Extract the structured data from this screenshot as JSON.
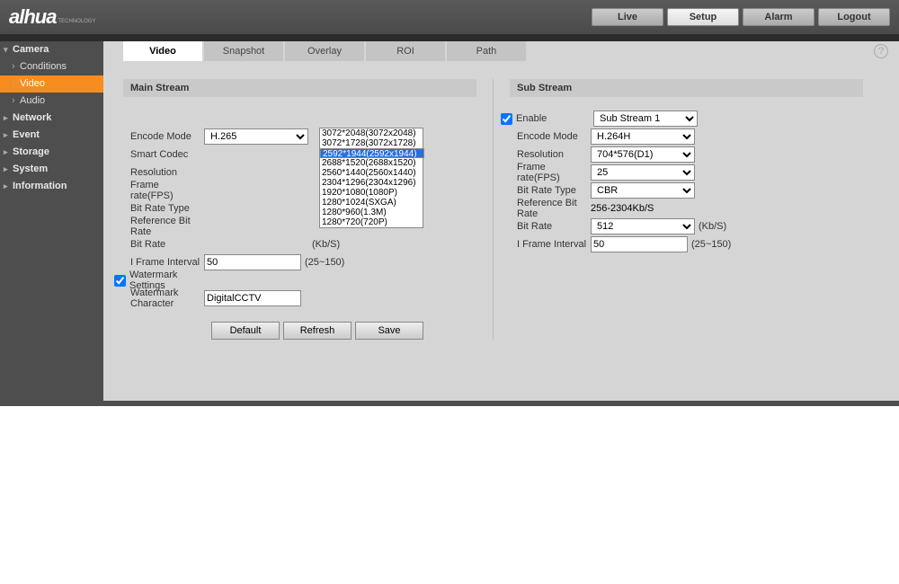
{
  "brand": {
    "name": "alhua",
    "sub": "TECHNOLOGY"
  },
  "nav": {
    "live": "Live",
    "setup": "Setup",
    "alarm": "Alarm",
    "logout": "Logout"
  },
  "sidebar": {
    "camera": "Camera",
    "conditions": "Conditions",
    "video": "Video",
    "audio": "Audio",
    "network": "Network",
    "event": "Event",
    "storage": "Storage",
    "system": "System",
    "information": "Information"
  },
  "tabs": {
    "video": "Video",
    "snapshot": "Snapshot",
    "overlay": "Overlay",
    "roi": "ROI",
    "path": "Path"
  },
  "main": {
    "title": "Main Stream",
    "encode_mode_lbl": "Encode Mode",
    "encode_mode": "H.265",
    "smart_codec_lbl": "Smart Codec",
    "resolution_lbl": "Resolution",
    "fps_lbl": "Frame rate(FPS)",
    "brt_lbl": "Bit Rate Type",
    "ref_lbl": "Reference Bit Rate",
    "br_lbl": "Bit Rate",
    "br_unit": "(Kb/S)",
    "ifi_lbl": "I Frame Interval",
    "ifi": "50",
    "ifi_range": "(25~150)",
    "wm_lbl": "Watermark Settings",
    "wmc_lbl": "Watermark Character",
    "wmc": "DigitalCCTV",
    "res_options": [
      "3072*2048(3072x2048)",
      "3072*1728(3072x1728)",
      "2592*1944(2592x1944)",
      "2688*1520(2688x1520)",
      "2560*1440(2560x1440)",
      "2304*1296(2304x1296)",
      "1920*1080(1080P)",
      "1280*1024(SXGA)",
      "1280*960(1.3M)",
      "1280*720(720P)"
    ]
  },
  "sub": {
    "title": "Sub Stream",
    "enable_lbl": "Enable",
    "enable_val": "Sub Stream 1",
    "encode_mode_lbl": "Encode Mode",
    "encode_mode": "H.264H",
    "resolution_lbl": "Resolution",
    "resolution": "704*576(D1)",
    "fps_lbl": "Frame rate(FPS)",
    "fps": "25",
    "brt_lbl": "Bit Rate Type",
    "brt": "CBR",
    "ref_lbl": "Reference Bit Rate",
    "ref": "256-2304Kb/S",
    "br_lbl": "Bit Rate",
    "br": "512",
    "br_unit": "(Kb/S)",
    "ifi_lbl": "I Frame Interval",
    "ifi": "50",
    "ifi_range": "(25~150)"
  },
  "buttons": {
    "default": "Default",
    "refresh": "Refresh",
    "save": "Save"
  }
}
